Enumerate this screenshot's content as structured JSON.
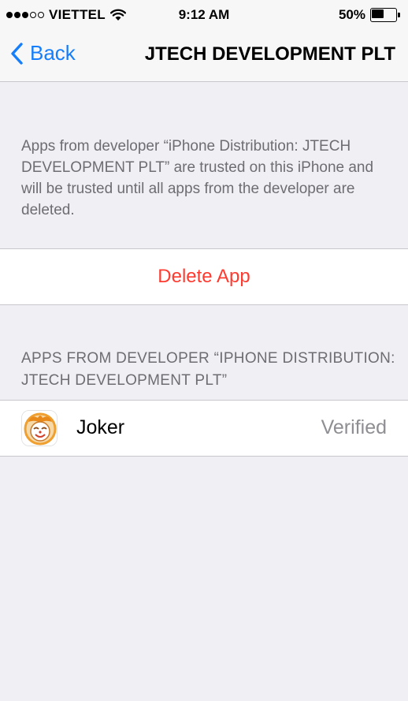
{
  "status_bar": {
    "carrier": "VIETTEL",
    "time": "9:12 AM",
    "battery_percent": "50%",
    "battery_level": 0.5,
    "signal_bars_filled": 3,
    "signal_bars_total": 5
  },
  "nav": {
    "back_label": "Back",
    "title": "JTECH DEVELOPMENT PLT"
  },
  "description": "Apps from developer “iPhone Distribution: JTECH DEVELOPMENT PLT” are trusted on this iPhone and will be trusted until all apps from the developer are deleted.",
  "delete_button": {
    "label": "Delete App",
    "color": "#ff3b30"
  },
  "apps_section": {
    "header": "APPS FROM DEVELOPER “IPHONE DISTRIBUTION: JTECH DEVELOPMENT PLT”",
    "apps": [
      {
        "name": "Joker",
        "status": "Verified",
        "icon": "joker-app-icon"
      }
    ]
  },
  "colors": {
    "accent": "#157efb",
    "background": "#efeff4",
    "secondary_text": "#6d6d72",
    "destructive": "#ff3b30"
  }
}
